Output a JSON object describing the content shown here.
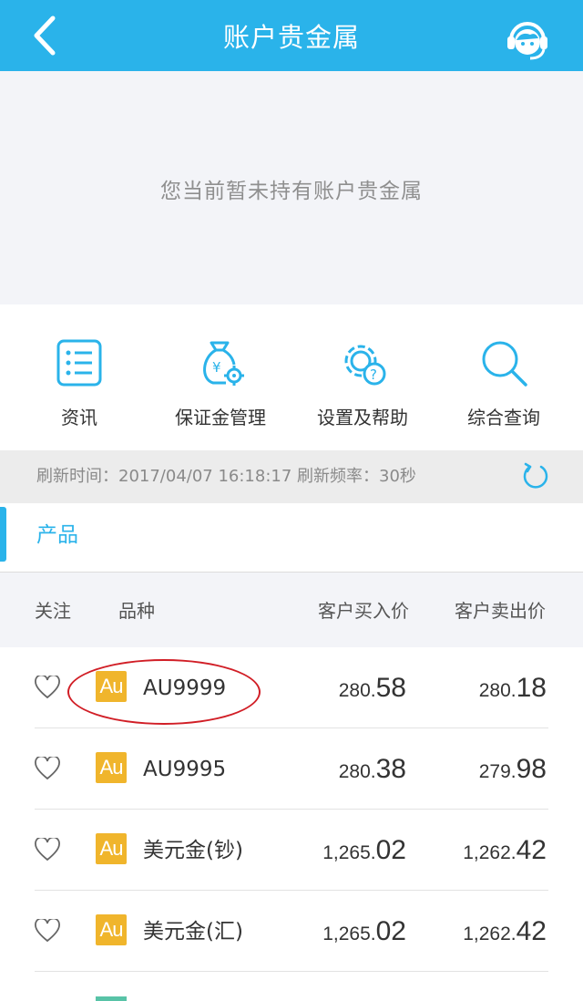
{
  "header": {
    "title": "账户贵金属",
    "back_icon": "chevron-left-icon",
    "service_icon": "customer-service-icon"
  },
  "holdings": {
    "empty_text": "您当前暂未持有账户贵金属"
  },
  "quick_menu": [
    {
      "label": "资讯",
      "icon": "list-icon"
    },
    {
      "label": "保证金管理",
      "icon": "money-bag-gear-icon"
    },
    {
      "label": "设置及帮助",
      "icon": "gear-help-icon"
    },
    {
      "label": "综合查询",
      "icon": "search-icon"
    }
  ],
  "refresh": {
    "text": "刷新时间：2017/04/07  16:18:17   刷新频率：30秒",
    "icon": "refresh-icon"
  },
  "section": {
    "title": "产品"
  },
  "table": {
    "headers": {
      "follow": "关注",
      "variety": "品种",
      "buy": "客户买入价",
      "sell": "客户卖出价"
    },
    "rows": [
      {
        "icon_text": "Au",
        "name": "AU9999",
        "buy_int": "280.",
        "buy_dec": "58",
        "sell_int": "280.",
        "sell_dec": "18"
      },
      {
        "icon_text": "Au",
        "name": "AU9995",
        "buy_int": "280.",
        "buy_dec": "38",
        "sell_int": "279.",
        "sell_dec": "98"
      },
      {
        "icon_text": "Au",
        "name": "美元金(钞)",
        "buy_int": "1,265.",
        "buy_dec": "02",
        "sell_int": "1,262.",
        "sell_dec": "42"
      },
      {
        "icon_text": "Au",
        "name": "美元金(汇)",
        "buy_int": "1,265.",
        "buy_dec": "02",
        "sell_int": "1,262.",
        "sell_dec": "42"
      }
    ]
  },
  "colors": {
    "accent": "#2ab3ea",
    "gold_icon": "#f0b52c",
    "annotation": "#d11e26"
  }
}
